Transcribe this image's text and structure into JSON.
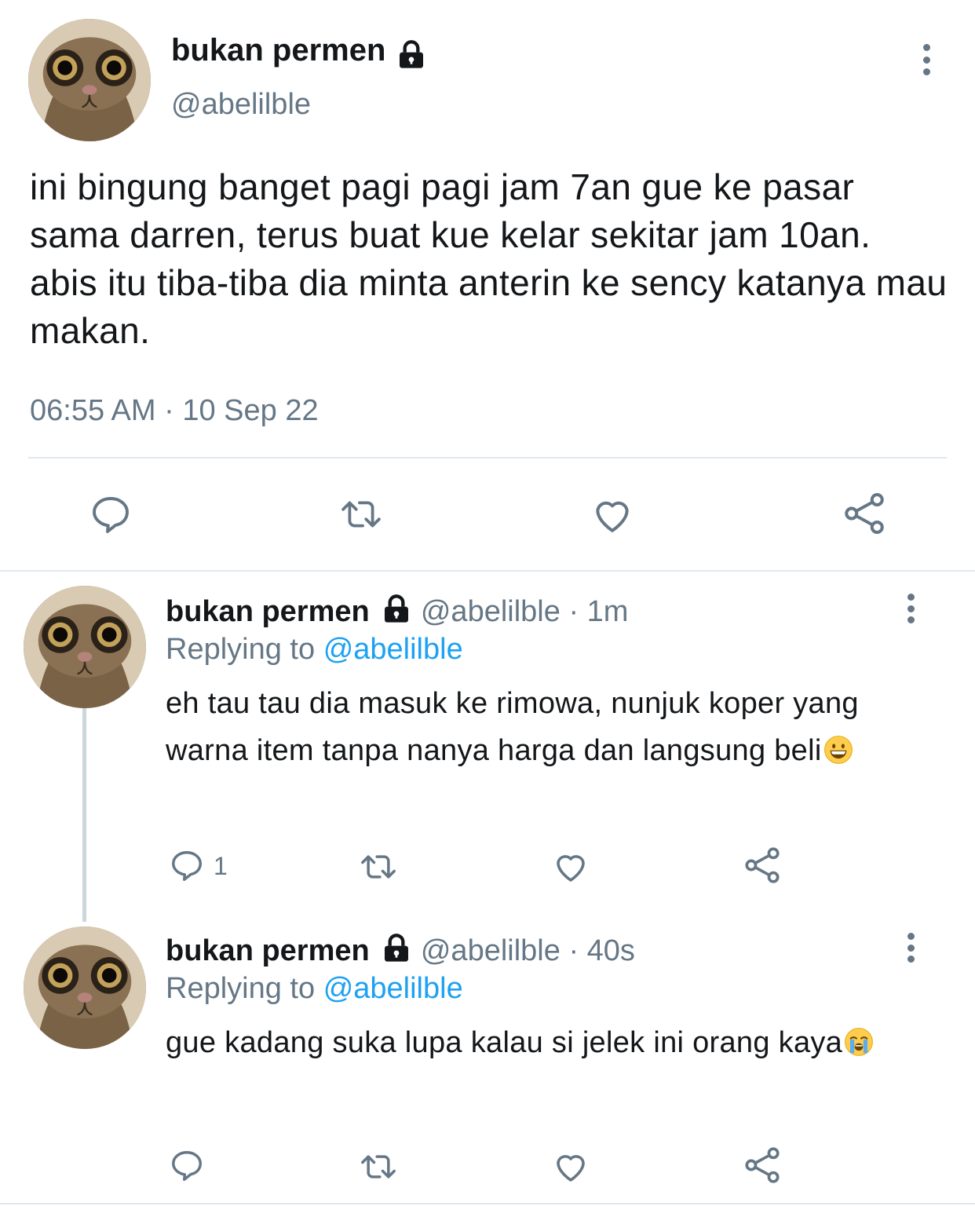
{
  "main_tweet": {
    "display_name": "bukan permen",
    "handle": "@abelilble",
    "text": "ini bingung banget pagi pagi jam 7an gue ke pasar sama darren, terus buat kue kelar sekitar jam 10an. abis itu tiba-tiba dia minta anterin ke sency katanya mau makan.",
    "timestamp": "06:55 AM · 10 Sep 22"
  },
  "replies": [
    {
      "display_name": "bukan permen",
      "handle": "@abelilble",
      "time": "· 1m",
      "replying_label": "Replying to",
      "replying_to": "@abelilble",
      "text": "eh tau tau dia masuk ke rimowa, nunjuk koper yang warna item tanpa nanya harga dan langsung beli",
      "emoji": "grinning-face",
      "reply_count": "1"
    },
    {
      "display_name": "bukan permen",
      "handle": "@abelilble",
      "time": "· 40s",
      "replying_label": "Replying to",
      "replying_to": "@abelilble",
      "text": "gue kadang suka lupa kalau si jelek ini orang kaya",
      "emoji": "loudly-crying-face",
      "reply_count": ""
    }
  ],
  "colors": {
    "text": "#14171a",
    "secondary": "#657786",
    "link": "#1da1f2",
    "divider": "#e1e8ed"
  },
  "icons": [
    "lock-icon",
    "more-icon",
    "reply-icon",
    "retweet-icon",
    "like-icon",
    "share-icon"
  ]
}
